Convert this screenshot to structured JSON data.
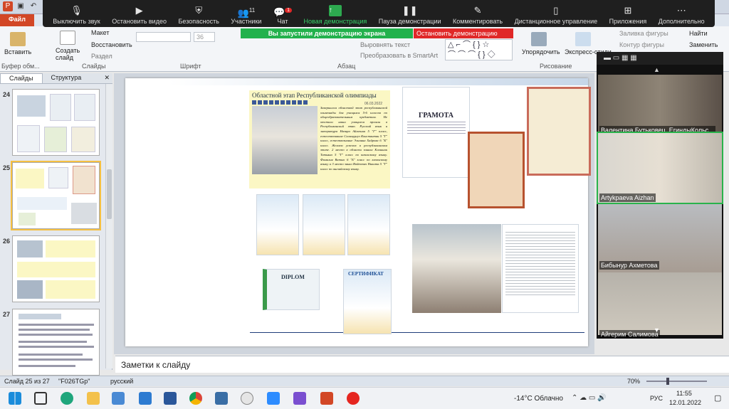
{
  "ribbon_tabs": [
    "Файл"
  ],
  "zoom_toolbar": {
    "items": [
      {
        "label": "Выключить звук",
        "icon": "microphone-icon"
      },
      {
        "label": "Остановить видео",
        "icon": "camera-icon"
      },
      {
        "label": "Безопасность",
        "icon": "shield-icon"
      },
      {
        "label": "Участники",
        "icon": "participants-icon",
        "badge": "11"
      },
      {
        "label": "Чат",
        "icon": "chat-icon",
        "badge": "1"
      },
      {
        "label": "Новая демонстрация",
        "icon": "share-arrow-icon"
      },
      {
        "label": "Пауза демонстрации",
        "icon": "pause-icon"
      },
      {
        "label": "Комментировать",
        "icon": "pen-icon"
      },
      {
        "label": "Дистанционное управление",
        "icon": "mouse-icon"
      },
      {
        "label": "Приложения",
        "icon": "apps-icon"
      },
      {
        "label": "Дополнительно",
        "icon": "more-icon"
      }
    ],
    "share_banner": "Вы запустили демонстрацию экрана",
    "stop_share": "Остановить демонстрацию"
  },
  "ribbon": {
    "paste": "Вставить",
    "create_slide": "Создать слайд",
    "layout": "Макет",
    "restore": "Восстановить",
    "section": "Раздел",
    "font_size": "36",
    "align_text": "Выровнять текст",
    "smartart": "Преобразовать в SmartArt",
    "arrange": "Упорядочить",
    "quick_styles": "Экспресс-стили",
    "shape_fill": "Заливка фигуры",
    "shape_outline": "Контур фигуры",
    "find": "Найти",
    "replace": "Заменить",
    "groups": {
      "clipboard": "Буфер обм...",
      "slides": "Слайды",
      "font": "Шрифт",
      "paragraph": "Абзац",
      "drawing": "Рисование"
    }
  },
  "left_panel": {
    "tabs": [
      "Слайды",
      "Структура"
    ],
    "slides": [
      {
        "number": "24"
      },
      {
        "number": "25"
      },
      {
        "number": "26"
      },
      {
        "number": "27"
      }
    ]
  },
  "slide": {
    "box_title": "Областной этап Республиканской олимпиады",
    "box_date": "06.03.2022",
    "body_text": "Завершился областной этап республиканской олимпиады для учащихся 5-6 классов по общеобразовательным предметам. Не отстали наши учащиеся прошли в Республиканский этап. Русский язык и литература Назира Айгазина 5 \"Г\" класс, естествознание Салимургуз Константин 5 \"Г\" класс, естествознание Элианна Хайрова 6 \"Б\" класс. Желаем успехов в республиканском этапе. 2 место в области заняла Клашник Татьяна 5 \"Г\" класс по казахскому языку. Фамилия Ватыо 6 \"Б\" класс по казахскому языку и 3 место занял Войтевич Никита 5 \"Г\" класс по английскому языку.",
    "gramota": "ГРАМОТА",
    "diploma": "DIPLOM",
    "certificate": "СЕРТИФИКАТ"
  },
  "notes_placeholder": "Заметки к слайду",
  "statusbar": {
    "slide": "Слайд 25 из 27",
    "theme": "\"F026TGp\"",
    "language": "русский",
    "zoom": "70%"
  },
  "participants": [
    {
      "name": "Валентина Бутьковец, ЕгиндыКольс..."
    },
    {
      "name": "Artykpaeva Aizhan"
    },
    {
      "name": "Бибынур Ахметова"
    },
    {
      "name": "Айгерим Салимова"
    }
  ],
  "taskbar": {
    "weather": "-14°C Облачно",
    "lang": "РУС",
    "time": "11:55",
    "date": "12.01.2022"
  }
}
